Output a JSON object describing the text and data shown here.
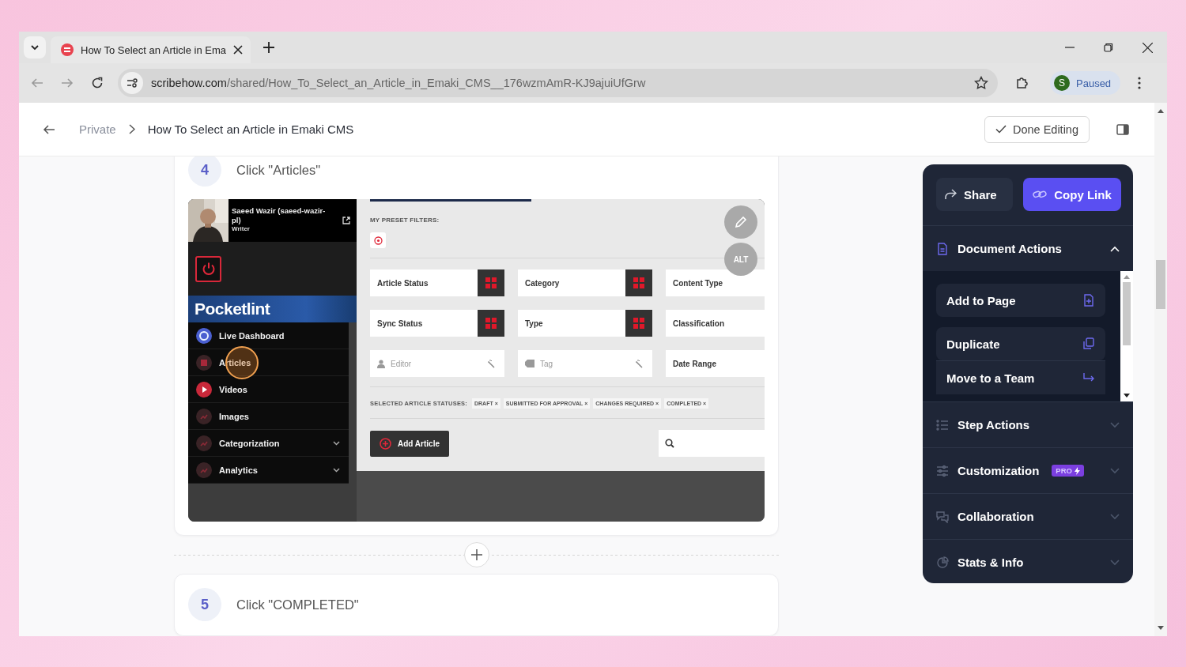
{
  "browser": {
    "tab": {
      "title": "How To Select an Article in Ema"
    },
    "url": {
      "domain": "scribehow.com",
      "path": "/shared/How_To_Select_an_Article_in_Emaki_CMS__176wzmAmR-KJ9ajuiUfGrw"
    },
    "profile": {
      "initial": "S",
      "status": "Paused"
    }
  },
  "header": {
    "breadcrumb": [
      {
        "label": "Private",
        "current": false
      },
      {
        "label": "How To Select an Article in Emaki CMS",
        "current": true
      }
    ],
    "done_button": "Done Editing"
  },
  "steps": [
    {
      "number": "4",
      "title": "Click \"Articles\"",
      "kind": "screenshot"
    },
    {
      "number": "5",
      "title": "Click \"COMPLETED\"",
      "kind": "text"
    }
  ],
  "screenshot": {
    "user": {
      "name": "Saeed Wazir (saeed-wazir-pl)",
      "role": "Writer"
    },
    "brand": "Pocketlint",
    "nav": [
      {
        "label": "Live Dashboard",
        "has_submenu": false,
        "clicked": false
      },
      {
        "label": "Articles",
        "has_submenu": false,
        "clicked": true
      },
      {
        "label": "Videos",
        "has_submenu": false,
        "clicked": false
      },
      {
        "label": "Images",
        "has_submenu": false,
        "clicked": false
      },
      {
        "label": "Categorization",
        "has_submenu": true,
        "clicked": false
      },
      {
        "label": "Analytics",
        "has_submenu": true,
        "clicked": false
      }
    ],
    "presets_label": "MY PRESET FILTERS:",
    "alt_button": "ALT",
    "filters": [
      {
        "label": "Article Status",
        "kind": "grid"
      },
      {
        "label": "Category",
        "kind": "grid"
      },
      {
        "label": "Content Type",
        "kind": "plain"
      },
      {
        "label": "Sync Status",
        "kind": "grid"
      },
      {
        "label": "Type",
        "kind": "grid"
      },
      {
        "label": "Classification",
        "kind": "plain"
      },
      {
        "placeholder": "Editor",
        "kind": "lookup"
      },
      {
        "placeholder": "Tag",
        "kind": "lookup"
      },
      {
        "label": "Date Range",
        "kind": "plain"
      }
    ],
    "statuses_label": "SELECTED ARTICLE STATUSES:",
    "statuses": [
      "DRAFT ×",
      "SUBMITTED FOR APPROVAL ×",
      "CHANGES REQUIRED ×",
      "COMPLETED ×"
    ],
    "add_button": "Add Article"
  },
  "panel": {
    "share": "Share",
    "copy_link": "Copy Link",
    "sections": [
      {
        "title": "Document Actions",
        "expanded": true,
        "items": [
          "Add to Page",
          "Duplicate",
          "Move to a Team"
        ]
      },
      {
        "title": "Step Actions",
        "expanded": false
      },
      {
        "title": "Customization",
        "expanded": false,
        "badge": "PRO"
      },
      {
        "title": "Collaboration",
        "expanded": false
      },
      {
        "title": "Stats & Info",
        "expanded": false
      }
    ]
  }
}
